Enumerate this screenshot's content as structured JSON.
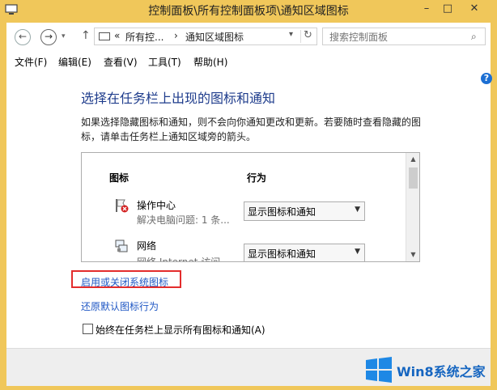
{
  "window": {
    "title": "控制面板\\所有控制面板项\\通知区域图标",
    "minimize": "–",
    "maximize": "□",
    "close": "✕"
  },
  "nav": {
    "back": "←",
    "forward": "→",
    "up": "↑",
    "dropdown": "▾",
    "address_segments": [
      "«",
      "所有控...",
      "›",
      "通知区域图标"
    ],
    "refresh": "↻",
    "search_placeholder": "搜索控制面板",
    "search_icon": "⌕"
  },
  "menu": [
    "文件(F)",
    "编辑(E)",
    "查看(V)",
    "工具(T)",
    "帮助(H)"
  ],
  "content": {
    "help": "?",
    "heading": "选择在任务栏上出现的图标和通知",
    "description": "如果选择隐藏图标和通知，则不会向你通知更改和更新。若要随时查看隐藏的图标，请单击任务栏上通知区域旁的箭头。",
    "columns": {
      "icon": "图标",
      "behavior": "行为"
    },
    "rows": [
      {
        "name": "操作中心",
        "subtext": "解决电脑问题: 1 条...",
        "behavior": "显示图标和通知",
        "icon": "flag-icon"
      },
      {
        "name": "网络",
        "subtext": "网络 Internet 访问",
        "behavior": "显示图标和通知",
        "icon": "network-icon"
      }
    ],
    "link_enable": "启用或关闭系统图标",
    "link_restore": "还原默认图标行为",
    "checkbox_label": "始终在任务栏上显示所有图标和通知(A)"
  },
  "watermark": {
    "text": "Win8系统之家",
    "color": "#1565c0"
  }
}
